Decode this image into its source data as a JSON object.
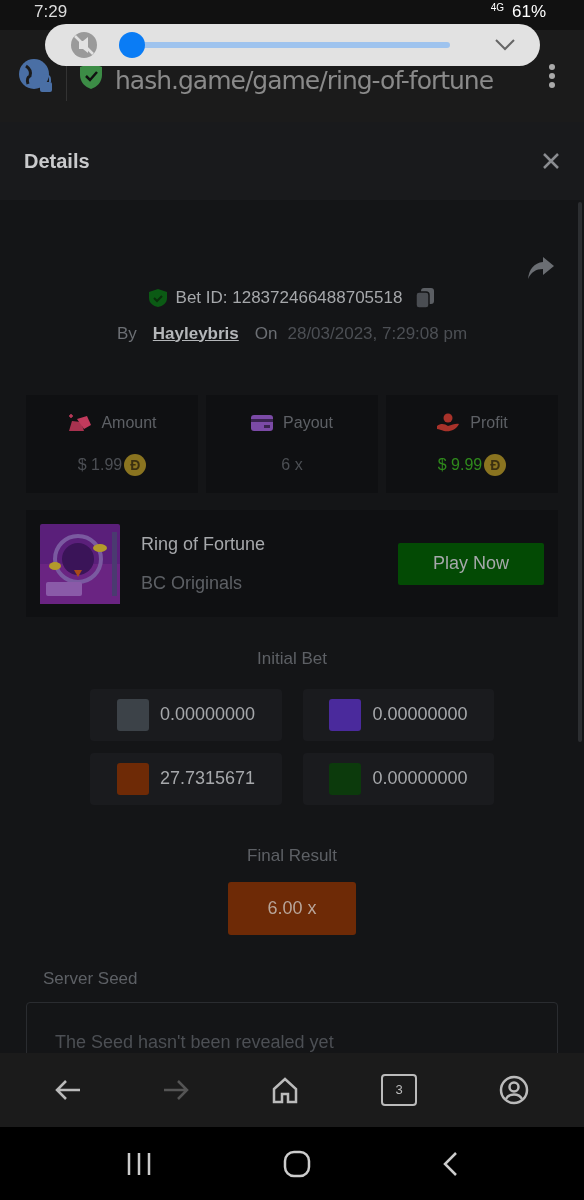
{
  "status_bar": {
    "time": "7:29",
    "network": "4G",
    "battery": "61%"
  },
  "volume_popup": {
    "level": 0.0
  },
  "browser": {
    "url": "hash.game/game/ring-of-fortune",
    "tab_count": "3"
  },
  "details": {
    "title": "Details"
  },
  "bet": {
    "id": "Bet ID: 128372466488705518",
    "by": "By",
    "user": "Hayleybris",
    "on": "On",
    "date": "28/03/2023, 7:29:08 pm"
  },
  "stats": [
    {
      "kind": "amount",
      "label": "Amount",
      "value": "$ 1.99",
      "coin": "Đ"
    },
    {
      "kind": "payout",
      "label": "Payout",
      "value": "6 x"
    },
    {
      "kind": "profit",
      "label": "Profit",
      "value": "$ 9.99",
      "coin": "Đ"
    }
  ],
  "game": {
    "title": "Ring of Fortune",
    "provider": "BC Originals",
    "button": "Play Now"
  },
  "initial_bet": {
    "title": "Initial Bet",
    "items": [
      {
        "color": "#3c4248",
        "value": "0.00000000"
      },
      {
        "color": "#4a2a9c",
        "value": "0.00000000"
      },
      {
        "color": "#6e2a06",
        "value": "27.7315671"
      },
      {
        "color": "#0c3a0c",
        "value": "0.00000000"
      }
    ]
  },
  "final_result": {
    "title": "Final Result",
    "value": "6.00 x"
  },
  "server_seed": {
    "label": "Server Seed",
    "text": "The Seed hasn't been revealed yet"
  }
}
